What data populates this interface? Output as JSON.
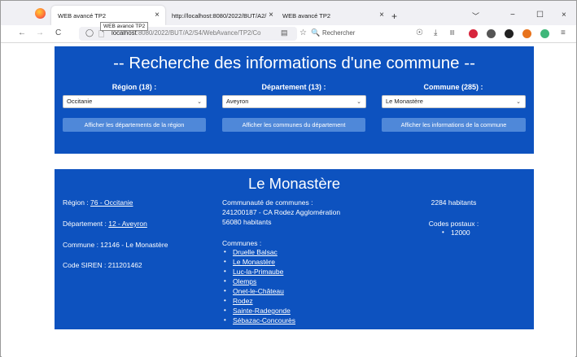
{
  "browser": {
    "tabs": [
      {
        "title": "WEB avancé TP2",
        "close": "×"
      },
      {
        "title": "http://localhost:8080/2022/BUT/A2/",
        "close": "×"
      },
      {
        "title": "WEB avancé TP2",
        "close": "×"
      }
    ],
    "new_tab": "+",
    "tooltip": "WEB avancé TP2",
    "url_host": "localhost",
    "url_rest": ":8080/2022/BUT/A2/S4/WebAvance/TP2/Co",
    "search_placeholder": "Rechercher",
    "glyphs": {
      "back": "←",
      "forward": "→",
      "reload": "C",
      "shield": "◯",
      "page": "🗋",
      "reader": "▤",
      "star": "☆",
      "search": "🔍",
      "minimize": "−",
      "maximize": "☐",
      "close": "×",
      "tabs_down": "﹀",
      "pocket": "☉",
      "download": "⤓",
      "library": "lll",
      "menu": "≡"
    }
  },
  "search_panel": {
    "title": "-- Recherche des informations d'une commune --",
    "region_label": "Région (18) :",
    "departement_label": "Département (13) :",
    "commune_label": "Commune (285) :",
    "region_value": "Occitanie",
    "departement_value": "Aveyron",
    "commune_value": "Le Monastère",
    "chevron": "⌄",
    "btn_departements": "Afficher les départements de la région",
    "btn_communes": "Afficher les communes du département",
    "btn_infos": "Afficher les informations de la commune"
  },
  "commune": {
    "name": "Le Monastère",
    "region_prefix": "Région : ",
    "region_link": "76 - Occitanie",
    "departement_prefix": "Département : ",
    "departement_link": "12 - Aveyron",
    "commune_line": "Commune : 12146 - Le Monastère",
    "siren_line": "Code SIREN : 211201462",
    "cc_label": "Communauté de communes :",
    "cc_name": "241200187 - CA Rodez Agglomération",
    "cc_population": "56080 habitants",
    "communes_label": "Communes :",
    "communes_list": [
      "Druelle Balsac",
      "Le Monastère",
      "Luc-la-Primaube",
      "Olemps",
      "Onet-le-Château",
      "Rodez",
      "Sainte-Radegonde",
      "Sébazac-Concourès"
    ],
    "population": "2284 habitants",
    "postal_label": "Codes postaux :",
    "postal_codes": [
      "12000"
    ],
    "bullet": "•"
  },
  "colors": {
    "panel": "#0d52bf",
    "button": "#4f88d9"
  }
}
